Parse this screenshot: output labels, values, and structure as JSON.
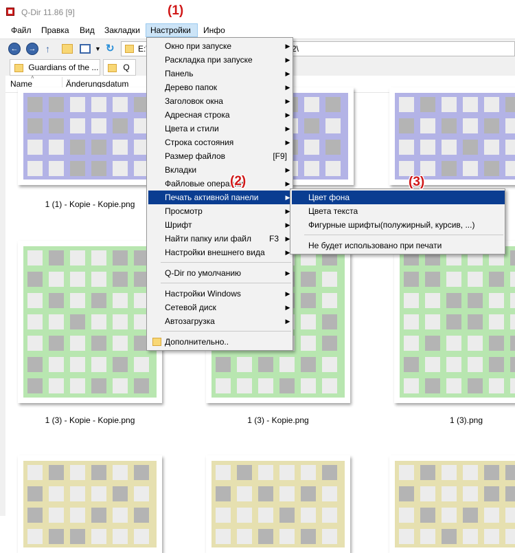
{
  "window": {
    "title": "Q-Dir 11.86 [9]"
  },
  "menubar": [
    {
      "label": "Файл",
      "active": false
    },
    {
      "label": "Правка",
      "active": false
    },
    {
      "label": "Вид",
      "active": false
    },
    {
      "label": "Закладки",
      "active": false
    },
    {
      "label": "Настройки",
      "active": true
    },
    {
      "label": "Инфо",
      "active": false
    }
  ],
  "address": {
    "left": "E:\\",
    "right": "2\\"
  },
  "tabs": [
    {
      "label": "Guardians of the ..."
    },
    {
      "label": "Q"
    }
  ],
  "columns": {
    "name": "Name",
    "date": "Änderungsdatum"
  },
  "files": [
    {
      "label": "1 (1) - Kopie - Kopie.png",
      "color": "#b3b3e6"
    },
    {
      "label": "",
      "color": "#b3b3e6"
    },
    {
      "label": "",
      "color": "#b3b3e6"
    },
    {
      "label": "1 (3) - Kopie - Kopie.png",
      "color": "#b8e6b0"
    },
    {
      "label": "1 (3) - Kopie.png",
      "color": "#b8e6b0"
    },
    {
      "label": "1 (3).png",
      "color": "#b8e6b0"
    },
    {
      "label": "",
      "color": "#e6e0b0"
    },
    {
      "label": "",
      "color": "#e6e0b0"
    },
    {
      "label": "",
      "color": "#e6e0b0"
    }
  ],
  "settings_menu": {
    "items": [
      {
        "label": "Окно при запуске",
        "arrow": true
      },
      {
        "label": "Раскладка при запуске",
        "arrow": true
      },
      {
        "label": "Панель",
        "arrow": true
      },
      {
        "label": "Дерево папок",
        "arrow": true
      },
      {
        "label": "Заголовок окна",
        "arrow": true
      },
      {
        "label": "Адресная строка",
        "arrow": true
      },
      {
        "label": "Цвета и стили",
        "arrow": true
      },
      {
        "label": "Строка состояния",
        "arrow": true
      },
      {
        "label": "Размер файлов",
        "shortcut": "[F9]"
      },
      {
        "label": "Вкладки",
        "arrow": true
      },
      {
        "label": "Файловые операции",
        "arrow": true
      },
      {
        "label": "Печать активной панели",
        "arrow": true,
        "highlighted": true
      },
      {
        "label": "Просмотр",
        "arrow": true
      },
      {
        "label": "Шрифт",
        "arrow": true
      },
      {
        "label": "Найти папку или файл",
        "shortcut": "F3",
        "arrow": true
      },
      {
        "label": "Настройки внешнего вида",
        "arrow": true
      },
      {
        "separator": true
      },
      {
        "label": "Q-Dir по умолчанию",
        "arrow": true
      },
      {
        "separator": true
      },
      {
        "label": "Настройки Windows",
        "arrow": true
      },
      {
        "label": "Сетевой диск",
        "arrow": true
      },
      {
        "label": "Автозагрузка",
        "arrow": true
      },
      {
        "separator": true
      },
      {
        "label": "Дополнительно..",
        "icon": "folder-icon"
      }
    ]
  },
  "print_submenu": {
    "items": [
      {
        "label": "Цвет фона",
        "highlighted": true
      },
      {
        "label": "Цвета текста"
      },
      {
        "label": "Фигурные шрифты(полужирный, курсив, ...)"
      },
      {
        "separator": true
      },
      {
        "label": "Не будет использовано при печати"
      }
    ]
  },
  "markers": [
    "(1)",
    "(2)",
    "(3)"
  ],
  "colors": {
    "highlight": "#0a3d91",
    "marker": "#d01818",
    "menu_active": "#cce4f7"
  }
}
